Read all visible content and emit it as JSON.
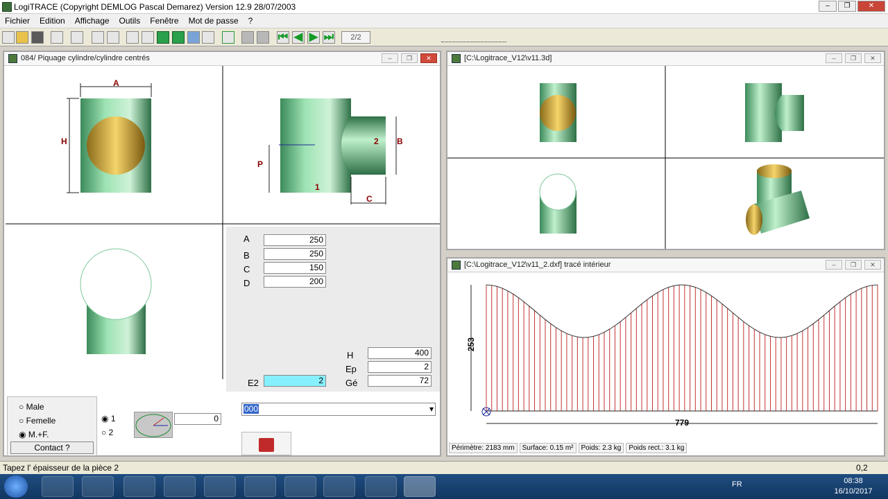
{
  "app": {
    "title": "LogiTRACE  (Copyright DEMLOG Pascal Demarez)  Version 12.9 28/07/2003",
    "window_buttons": [
      "–",
      "❐",
      "✕"
    ]
  },
  "menu": [
    "Fichier",
    "Edition",
    "Affichage",
    "Outils",
    "Fenêtre",
    "Mot de passe",
    "?"
  ],
  "toolbar": {
    "page_indicator": "2/2"
  },
  "left_window": {
    "title": "084/ Piquage cylindre/cylindre centrés",
    "dim_labels": {
      "A": "A",
      "H": "H",
      "P": "P",
      "B": "B",
      "C": "C",
      "n1": "1",
      "n2": "2"
    },
    "params": [
      {
        "label": "A",
        "value": "250"
      },
      {
        "label": "B",
        "value": "250"
      },
      {
        "label": "C",
        "value": "150"
      },
      {
        "label": "D",
        "value": "200"
      }
    ],
    "right_params": [
      {
        "label": "H",
        "value": "400"
      },
      {
        "label": "Ep",
        "value": "2"
      },
      {
        "label": "Gé",
        "value": "72"
      }
    ],
    "e2": {
      "label": "E2",
      "value": "2"
    },
    "gender_options": [
      "Male",
      "Femelle",
      "M.+F."
    ],
    "gender_selected": "M.+F.",
    "contact_label": "Contact ?",
    "piece_options": [
      "1",
      "2"
    ],
    "piece_selected": "1",
    "angle_value": "0",
    "combo_value": "000"
  },
  "top_right_window": {
    "title": "[C:\\Logitrace_V12\\v11.3d]"
  },
  "bottom_right_window": {
    "title": "[C:\\Logitrace_V12\\v11_2.dxf]  tracé intérieur",
    "dim_height": "253",
    "dim_width": "779",
    "status_fields": [
      "Périmètre: 2183 mm",
      "Surface: 0.15 m²",
      "Poids: 2.3 kg",
      "Poids rect.: 3.1 kg"
    ]
  },
  "statusbar": {
    "message": "Tapez l' épaisseur de la pièce 2",
    "value": "0,2"
  },
  "taskbar": {
    "lang": "FR",
    "time": "08:38",
    "date": "16/10/2017"
  }
}
